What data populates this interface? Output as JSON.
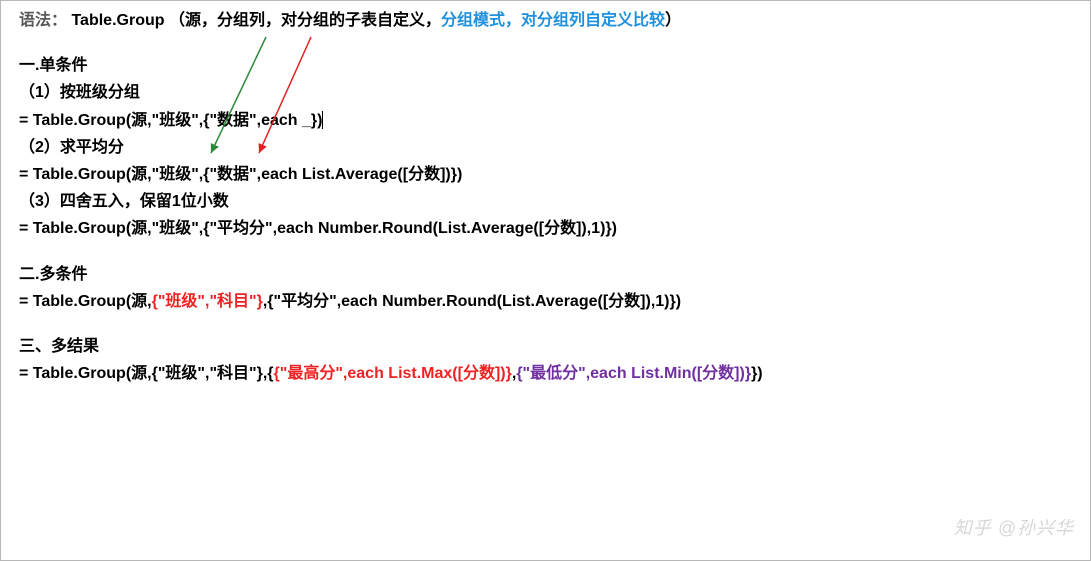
{
  "syntax": {
    "label": "语法：",
    "func": "Table.Group",
    "open": "（",
    "a1": "源，",
    "a2": "分组列，",
    "a3": "对分组的子表自定义，",
    "a4": "分组模式，",
    "a5": "对分组列自定义比较",
    "close": "）"
  },
  "sec1": {
    "title": "一.单条件",
    "p1": "（1）按班级分组",
    "c1": "= Table.Group(源,\"班级\",{\"数据\",each _})",
    "p2": "（2）求平均分",
    "c2": "= Table.Group(源,\"班级\",{\"数据\",each List.Average([分数])})",
    "p3": "（3）四舍五入，保留1位小数",
    "c3": "= Table.Group(源,\"班级\",{\"平均分\",each Number.Round(List.Average([分数]),1)})"
  },
  "sec2": {
    "title": "二.多条件",
    "code_pre": "= Table.Group(源,",
    "code_red": "{\"班级\",\"科目\"}",
    "code_post": ",{\"平均分\",each Number.Round(List.Average([分数]),1)})"
  },
  "sec3": {
    "title": "三、多结果",
    "code_pre": "= Table.Group(源,{\"班级\",\"科目\"},{",
    "code_red": "{\"最高分\",each List.Max([分数])}",
    "code_mid": ",",
    "code_purple": "{\"最低分\",each List.Min([分数])}",
    "code_post": "})"
  },
  "watermark": "知乎 @孙兴华"
}
